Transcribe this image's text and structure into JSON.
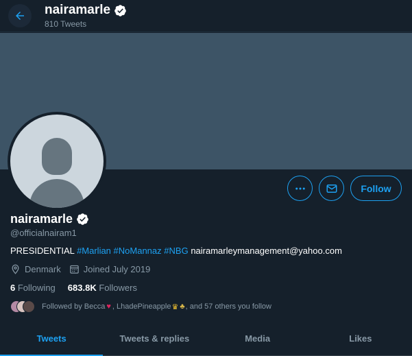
{
  "header": {
    "name": "nairamarle",
    "tweet_count": "810 Tweets"
  },
  "profile": {
    "name": "nairamarle",
    "handle": "@officialnairam1",
    "bio": {
      "prefix": "PRESIDENTIAL",
      "tags": [
        "#Marlian",
        "#NoMannaz",
        "#NBG"
      ],
      "email": "nairamarleymanagement@yahoo.com"
    },
    "location": "Denmark",
    "joined": "Joined July 2019",
    "following_count": "6",
    "following_label": "Following",
    "followers_count": "683.8K",
    "followers_label": "Followers",
    "followed_by": {
      "prefix": "Followed by Becca",
      "middle": ", LhadePineapple",
      "suffix": ", and 57 others you follow"
    }
  },
  "actions": {
    "follow_label": "Follow"
  },
  "tabs": [
    {
      "label": "Tweets",
      "active": true
    },
    {
      "label": "Tweets & replies",
      "active": false
    },
    {
      "label": "Media",
      "active": false
    },
    {
      "label": "Likes",
      "active": false
    }
  ],
  "colors": {
    "accent": "#1da1f2",
    "background": "#15202b",
    "banner": "#3d5466",
    "muted_text": "#8899a6"
  },
  "icons": {
    "back": "arrow-left-icon",
    "verified": "verified-badge-icon",
    "more": "more-dots-icon",
    "message": "envelope-icon",
    "location": "location-pin-icon",
    "calendar": "calendar-icon"
  }
}
